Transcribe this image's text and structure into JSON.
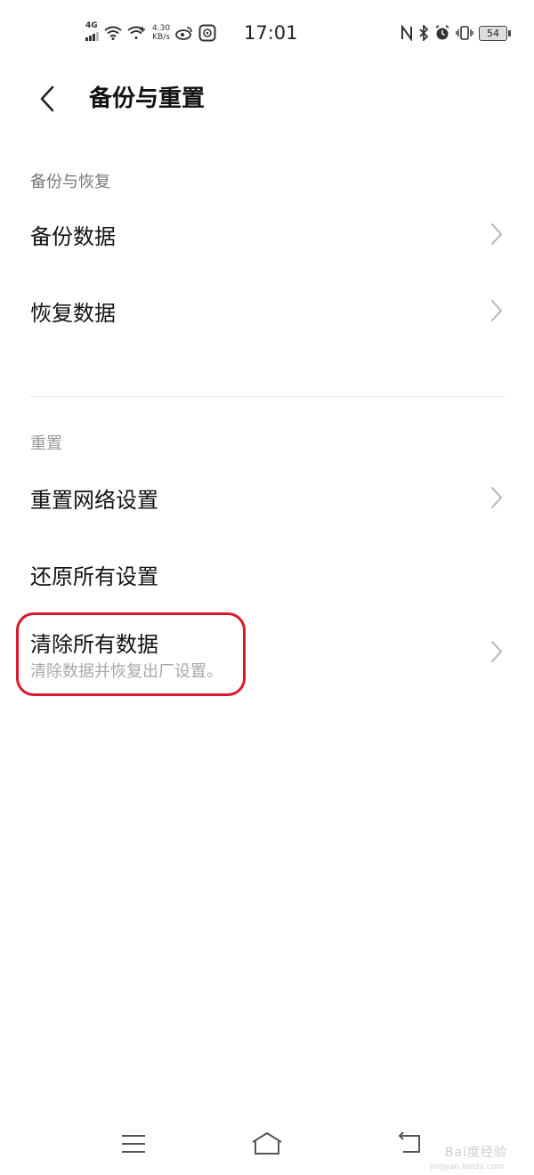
{
  "status_bar": {
    "network": "4G",
    "speed_value": "4.30",
    "speed_unit": "KB/s",
    "time": "17:01",
    "battery": "54",
    "icons": [
      "signal-icon",
      "wifi-icon",
      "wifi-plus-icon",
      "weibo-icon",
      "message-icon",
      "nfc-icon",
      "bluetooth-icon",
      "alarm-icon",
      "vibrate-icon",
      "battery-icon"
    ]
  },
  "header": {
    "title": "备份与重置",
    "back_icon": "back-arrow-icon"
  },
  "sections": {
    "backup": {
      "title": "备份与恢复",
      "items": [
        {
          "label": "备份数据"
        },
        {
          "label": "恢复数据"
        }
      ]
    },
    "reset": {
      "title": "重置",
      "items": [
        {
          "label": "重置网络设置"
        },
        {
          "label": "还原所有设置"
        },
        {
          "label": "清除所有数据",
          "sublabel": "清除数据并恢复出厂设置。"
        }
      ]
    }
  },
  "annotation": {
    "color": "#d7182a"
  },
  "nav_bar": {
    "icons": [
      "menu-icon",
      "home-icon",
      "back-nav-icon"
    ]
  },
  "watermark": {
    "brand": "Bai度经验",
    "url": "jingyan.baidu.com"
  }
}
